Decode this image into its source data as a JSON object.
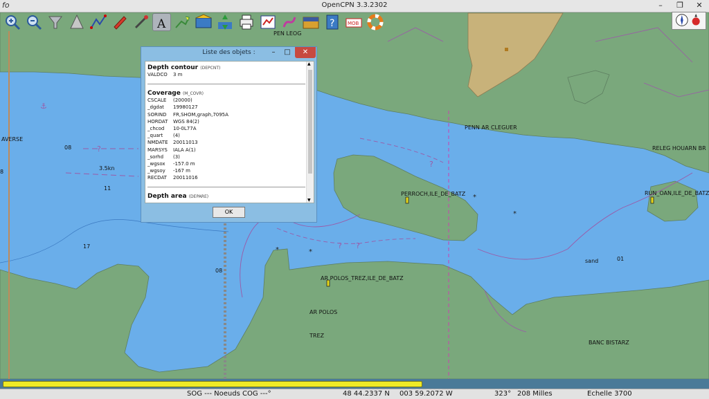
{
  "window": {
    "title": "OpenCPN 3.3.2302",
    "icon": "opencpn-icon"
  },
  "toolbar": [
    {
      "name": "zoom-in-icon"
    },
    {
      "name": "zoom-out-icon"
    },
    {
      "name": "chart-quilt-icon"
    },
    {
      "name": "scale-icon"
    },
    {
      "name": "route-icon"
    },
    {
      "name": "ship-icon"
    },
    {
      "name": "tools-icon"
    },
    {
      "name": "text-icon"
    },
    {
      "name": "track-icon"
    },
    {
      "name": "chart-bar-icon"
    },
    {
      "name": "tides-icon"
    },
    {
      "name": "print-icon"
    },
    {
      "name": "route-manager-icon"
    },
    {
      "name": "settings-icon"
    },
    {
      "name": "chart-icon"
    },
    {
      "name": "help-icon"
    },
    {
      "name": "mob-icon"
    },
    {
      "name": "lifebuoy-icon"
    }
  ],
  "map_labels": {
    "pen_leog": "PEN LEOG",
    "penn_ar_cleguer": "PENN AR CLEGUER",
    "releg": "RELEG HOUARN BR",
    "perroch": "PERROCH,ILE_DE_BATZ",
    "run_oan": "RUN_OAN,ILE_DE_BATZ",
    "ar_polos_trez": "AR POLOS_TREZ,ILE_DE_BATZ",
    "ar_polos": "AR POLOS",
    "trez": "TREZ",
    "banc_bistarz": "BANC BISTARZ",
    "sand": "sand",
    "averse": "AVERSE",
    "current": "3.5kn",
    "d08a": "08",
    "d11": "11",
    "d17": "17",
    "d08b": "08",
    "d01": "01",
    "d8": "8"
  },
  "dialog": {
    "title": "Liste des objets :",
    "ok_label": "OK",
    "section1": {
      "title": "Depth contour",
      "code": "(DEPCNT)",
      "rows": [
        {
          "k": "VALDCO",
          "v": "3 m"
        }
      ]
    },
    "section2": {
      "title": "Coverage",
      "code": "(M_COVR)",
      "rows": [
        {
          "k": "CSCALE",
          "v": "(20000)"
        },
        {
          "k": "_dgdat",
          "v": "19980127"
        },
        {
          "k": "SORIND",
          "v": "FR,SHOM,graph,7095A"
        },
        {
          "k": "HORDAT",
          "v": "WGS 84(2)"
        },
        {
          "k": "_chcod",
          "v": "10-0L77A"
        },
        {
          "k": "_quart",
          "v": "(4)"
        },
        {
          "k": "NMDATE",
          "v": "20011013"
        },
        {
          "k": "MARSYS",
          "v": "IALA A(1)"
        },
        {
          "k": "_sorhd",
          "v": "(3)"
        },
        {
          "k": "_wgsox",
          "v": "-157.0 m"
        },
        {
          "k": "_wgsoy",
          "v": "-167 m"
        },
        {
          "k": "RECDAT",
          "v": "20011016"
        }
      ]
    },
    "section3": {
      "title": "Depth area",
      "code": "(DEPARE)"
    }
  },
  "status": {
    "sog": "SOG --- Noeuds COG ---°",
    "lat": "48 44.2337 N",
    "lon": "003 59.2072 W",
    "bearing": "323°",
    "distance": "208 Milles",
    "scale": "Echelle 3700"
  },
  "colors": {
    "water": "#6aaeea",
    "land": "#7aa87c",
    "sand": "#c8b27a",
    "buoy": "#e3d51a"
  }
}
